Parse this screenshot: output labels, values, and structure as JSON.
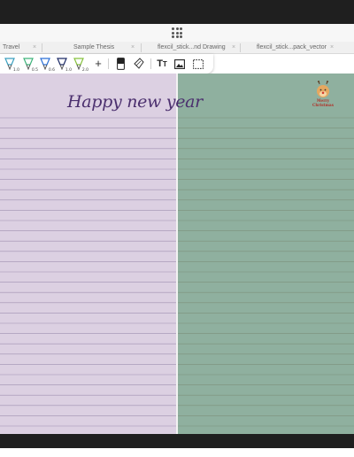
{
  "tabs": [
    {
      "label": "Travel"
    },
    {
      "label": "Sample Thesis"
    },
    {
      "label": "flexcil_stick...nd Drawing"
    },
    {
      "label": "flexcil_stick...pack_vector"
    }
  ],
  "tab_close_glyph": "×",
  "toolbar": {
    "pens": [
      {
        "name": "highlighter-icon",
        "size": "1.0",
        "color": "#3a9fbf"
      },
      {
        "name": "pen-icon",
        "size": "0.5",
        "color": "#3db37a"
      },
      {
        "name": "pen-icon",
        "size": "0.6",
        "color": "#2a6fd6"
      },
      {
        "name": "pen-icon",
        "size": "1.0",
        "color": "#1c2a66"
      },
      {
        "name": "pen-icon",
        "size": "2.0",
        "color": "#86c23d"
      }
    ],
    "add_label": "+",
    "text_tool_label": "T"
  },
  "page_left": {
    "heading": "Happy new year",
    "background": "#dcd0e2",
    "line_color": "#9f8fb0"
  },
  "page_right": {
    "sticker_text_line1": "Merry",
    "sticker_text_line2": "Christmas",
    "background": "#8fb09f",
    "line_color": "#7c8f7b"
  }
}
